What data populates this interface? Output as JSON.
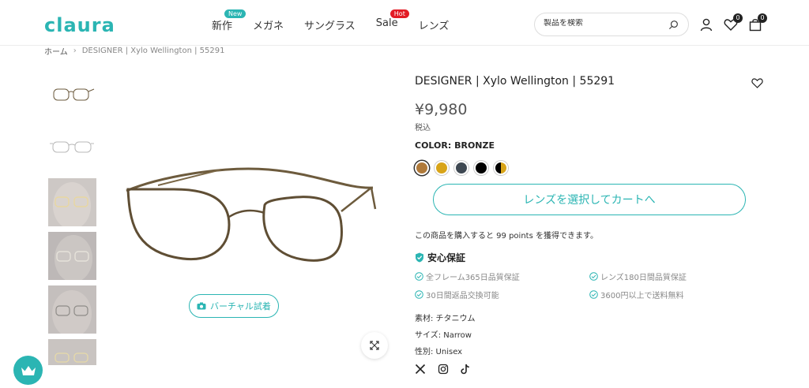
{
  "header": {
    "logo": "claura",
    "nav": [
      {
        "label": "新作",
        "badge": "New"
      },
      {
        "label": "メガネ",
        "badge": ""
      },
      {
        "label": "サングラス",
        "badge": ""
      },
      {
        "label": "Sale",
        "badge": "Hot"
      },
      {
        "label": "レンズ",
        "badge": ""
      }
    ],
    "search_placeholder": "製品を検索",
    "wishlist_count": "0",
    "cart_count": "0"
  },
  "breadcrumb": {
    "home": "ホーム",
    "current": "DESIGNER | Xylo Wellington | 55291"
  },
  "gallery": {
    "vto_label": "バーチャル試着",
    "icons": [
      "camera-icon",
      "expand-icon"
    ]
  },
  "product": {
    "title": "DESIGNER | Xylo Wellington | 55291",
    "price": "¥9,980",
    "tax_note": "税込",
    "color_label": "COLOR: BRONZE",
    "swatches": [
      "#b07a3a",
      "#d8a419",
      "#3e4852",
      "#000000",
      "#d8a419"
    ],
    "cta": "レンズを選択してカートへ",
    "points_note": "この商品を購入すると 99 points を獲得できます。",
    "guarantee_title": "安心保証",
    "guarantees": [
      "全フレーム365日品質保証",
      "レンズ180日間品質保証",
      "30日間返品交換可能",
      "3600円以上で送料無料"
    ],
    "specs": [
      "素材: チタニウム",
      "サイズ: Narrow",
      "性別: Unisex"
    ]
  },
  "colors": {
    "accent": "#2bb5b3",
    "hot": "#e31c25"
  }
}
